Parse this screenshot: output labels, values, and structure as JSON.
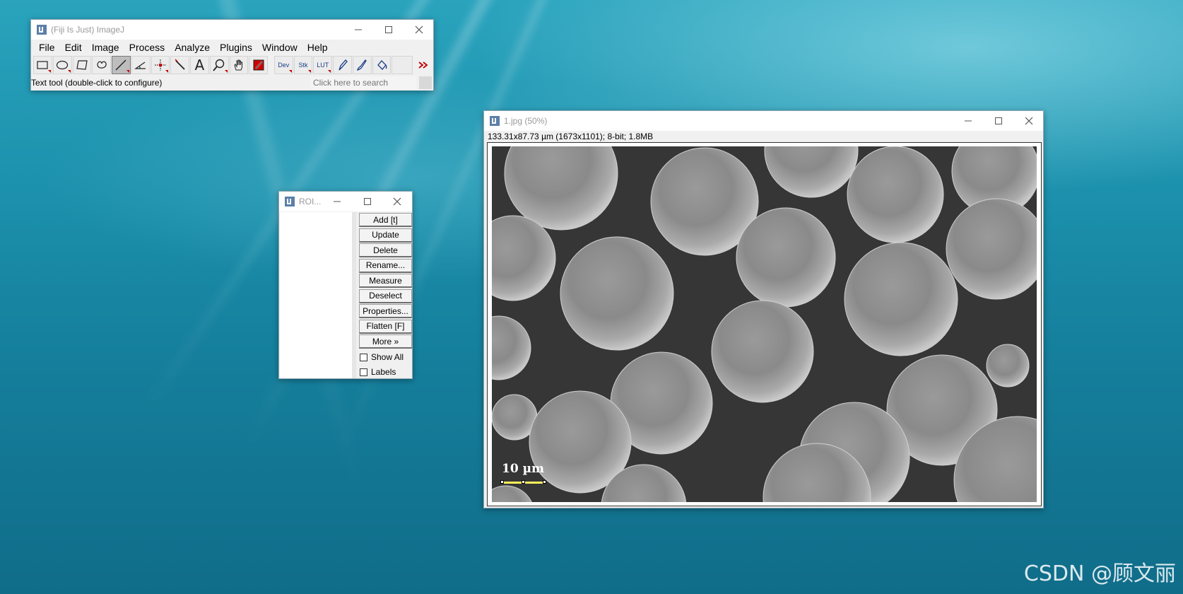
{
  "desktop": {
    "watermark": "CSDN @顾文丽"
  },
  "fiji": {
    "title": "(Fiji Is Just) ImageJ",
    "menu": [
      "File",
      "Edit",
      "Image",
      "Process",
      "Analyze",
      "Plugins",
      "Window",
      "Help"
    ],
    "tools": [
      {
        "name": "rectangle-tool",
        "icon": "rectangle-icon"
      },
      {
        "name": "oval-tool",
        "icon": "oval-icon"
      },
      {
        "name": "polygon-tool",
        "icon": "polygon-icon"
      },
      {
        "name": "freehand-tool",
        "icon": "freehand-icon"
      },
      {
        "name": "line-tool",
        "icon": "line-icon"
      },
      {
        "name": "angle-tool",
        "icon": "angle-icon"
      },
      {
        "name": "point-tool",
        "icon": "point-icon"
      },
      {
        "name": "wand-tool",
        "icon": "wand-icon"
      },
      {
        "name": "text-tool",
        "icon": "text-icon"
      },
      {
        "name": "zoom-tool",
        "icon": "magnifier-icon"
      },
      {
        "name": "hand-tool",
        "icon": "hand-icon"
      },
      {
        "name": "color-picker-tool",
        "icon": "color-picker-icon"
      }
    ],
    "tool_labels": {
      "text": "A",
      "dev": "Dev",
      "stk": "Stk",
      "lut": "LUT"
    },
    "status": "Text tool (double-click to configure)",
    "search_placeholder": "Click here to search",
    "accent_color": "#c00000"
  },
  "roi_manager": {
    "title": "ROI...",
    "buttons": [
      "Add [t]",
      "Update",
      "Delete",
      "Rename...",
      "Measure",
      "Deselect",
      "Properties...",
      "Flatten [F]",
      "More »"
    ],
    "checkboxes": [
      {
        "label": "Show All",
        "checked": false
      },
      {
        "label": "Labels",
        "checked": false
      }
    ]
  },
  "image_window": {
    "title": "1.jpg (50%)",
    "info": "133.31x87.73 µm (1673x1101); 8-bit; 1.8MB",
    "scale_label": "10 µm",
    "scale_bar_color": "#ffef5a"
  }
}
